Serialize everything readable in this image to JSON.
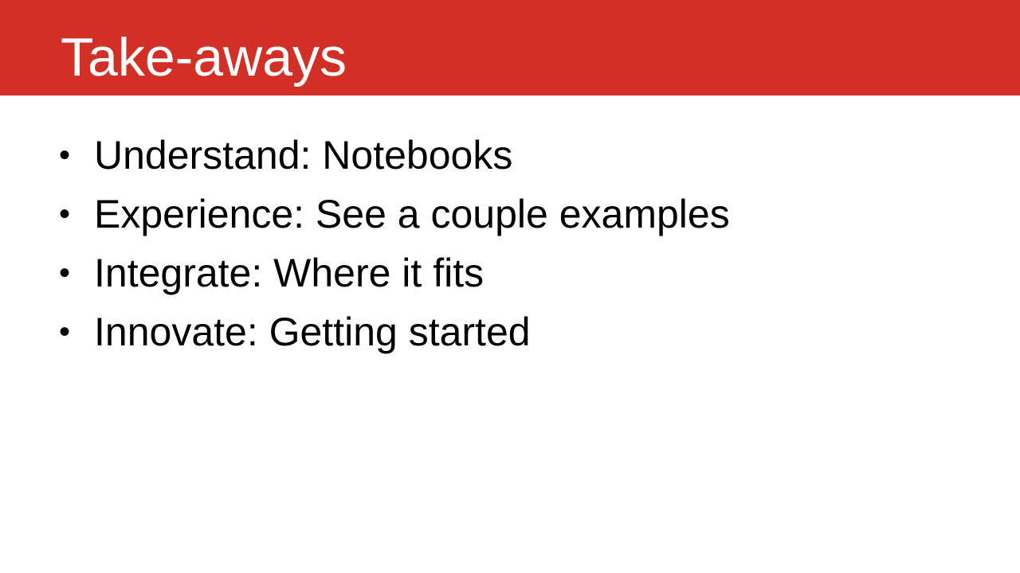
{
  "slide": {
    "title": "Take-aways",
    "colors": {
      "title_bar": "#d22f27",
      "title_text": "#ffffff",
      "body_text": "#000000",
      "background": "#ffffff"
    },
    "bullet_symbol": "•",
    "bullets": [
      {
        "text": "Understand: Notebooks"
      },
      {
        "text": "Experience: See a couple examples"
      },
      {
        "text": "Integrate: Where it fits"
      },
      {
        "text": "Innovate: Getting started"
      }
    ]
  }
}
